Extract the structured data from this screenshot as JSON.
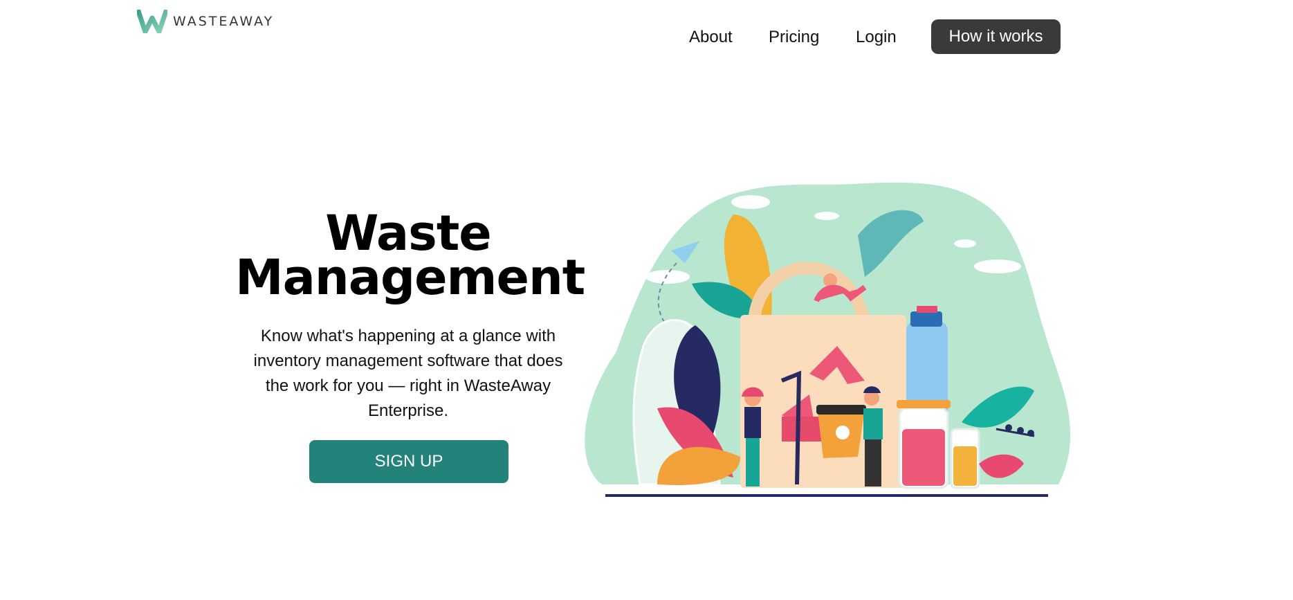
{
  "brand": {
    "name": "WASTEAWAY",
    "accent": "#4fae96"
  },
  "nav": {
    "items": [
      "About",
      "Pricing",
      "Login"
    ],
    "cta": "How it works"
  },
  "hero": {
    "title_line1": "Waste",
    "title_line2": "Management",
    "description": "Know what's happening at a glance with inventory management software that does the work for you — right in WasteAway Enterprise.",
    "signup_label": "SIGN UP",
    "signup_color": "#23827a"
  },
  "icons": [
    "w-logo-icon",
    "hero-illustration"
  ]
}
